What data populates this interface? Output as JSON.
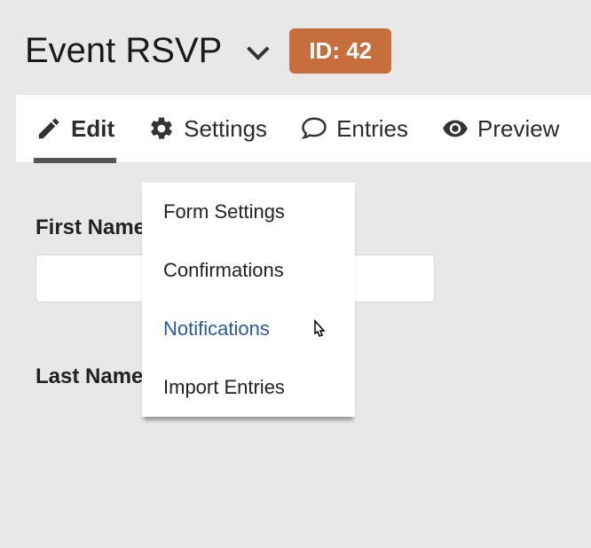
{
  "header": {
    "title": "Event RSVP",
    "id_label": "ID: 42"
  },
  "toolbar": {
    "items": [
      {
        "label": "Edit"
      },
      {
        "label": "Settings"
      },
      {
        "label": "Entries"
      },
      {
        "label": "Preview"
      }
    ]
  },
  "dropdown": {
    "items": [
      {
        "label": "Form Settings"
      },
      {
        "label": "Confirmations"
      },
      {
        "label": "Notifications"
      },
      {
        "label": "Import Entries"
      }
    ]
  },
  "form": {
    "first_name_label": "First Name",
    "last_name_label": "Last Name"
  }
}
